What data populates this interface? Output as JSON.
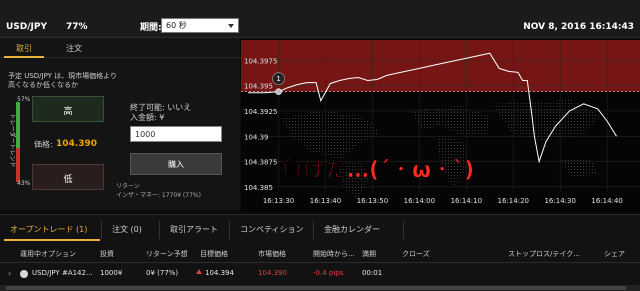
{
  "header": {
    "pair": "USD/JPY",
    "payout": "77%",
    "period_label": "期間:",
    "period_value": "60 秒",
    "datetime": "NOV 8, 2016 16:14:43"
  },
  "trade_panel": {
    "tabs": [
      {
        "label": "取引",
        "active": true
      },
      {
        "label": "注文",
        "active": false
      }
    ],
    "expectation_text": "予定 USD/JPY は、現市場価格より高くなるか低くなるか",
    "trader_trend_label": "トレーダートレンド",
    "high_pct": "57%",
    "low_pct": "43%",
    "high_pct_value": 57,
    "high_button": "高",
    "low_button": "低",
    "price_label": "価格:",
    "price_value": "104.390",
    "end_possible": "終了可能: いいえ",
    "deposit_label": "入金額: ¥",
    "amount_value": "1000",
    "purchase_button": "購入",
    "return_label": "リターン",
    "insider_money": "インザ・マネー: 1770¥ (77%)"
  },
  "chart_data": {
    "type": "line",
    "y_ticks": [
      "104.3975",
      "104.395",
      "104.3925",
      "104.39",
      "104.3875",
      "104.385"
    ],
    "y_tick_values": [
      104.3975,
      104.395,
      104.3925,
      104.39,
      104.3875,
      104.385
    ],
    "ylim": [
      104.3845,
      104.3995
    ],
    "x_ticks": [
      "16:13:30",
      "16:13:40",
      "16:13:50",
      "16:14:00",
      "16:14:10",
      "16:14:20",
      "16:14:30",
      "16:14:40"
    ],
    "x_tick_seconds": [
      0,
      10,
      20,
      30,
      40,
      50,
      60,
      70
    ],
    "xlim": [
      -8,
      77
    ],
    "series": [
      {
        "x": [
          -6.5,
          -3,
          0,
          2,
          4,
          6,
          8,
          9,
          11,
          13,
          15,
          17,
          19,
          21,
          23,
          25,
          27,
          29,
          31,
          33,
          35,
          37,
          39,
          41,
          43,
          45,
          47,
          49,
          51,
          52,
          53,
          54,
          54.5,
          55.5,
          57,
          59,
          62,
          65,
          68,
          70,
          72
        ],
        "y": [
          104.3943,
          104.3943,
          104.3944,
          104.3948,
          104.3951,
          104.3953,
          104.3953,
          104.3935,
          104.3952,
          104.3955,
          104.3957,
          104.3958,
          104.3955,
          104.3956,
          104.396,
          104.3962,
          104.3964,
          104.3966,
          104.3968,
          104.397,
          104.3972,
          104.3974,
          104.3976,
          104.3978,
          104.398,
          104.3982,
          104.3967,
          104.3964,
          104.3963,
          104.3955,
          104.3955,
          104.392,
          104.39,
          104.3875,
          104.3895,
          104.391,
          104.3925,
          104.3932,
          104.3927,
          104.3915,
          104.39
        ]
      }
    ],
    "entry_marker": {
      "label": "1",
      "x": 0,
      "y": 104.3944,
      "price_line": 104.3944
    },
    "annotation": "負けた…(´・ω・`)"
  },
  "colors": {
    "accent": "#e9b43a",
    "high_zone": "#8a1a17",
    "price": "#f0a500",
    "down": "#e04040"
  },
  "bottom": {
    "tabs": [
      {
        "label": "オープントレード (1)",
        "active": true
      },
      {
        "label": "注文 (0)",
        "active": false
      },
      {
        "label": "取引アラート",
        "active": false
      },
      {
        "label": "コンペティション",
        "active": false
      },
      {
        "label": "金融カレンダー",
        "active": false
      }
    ],
    "columns": [
      "運用中オプション",
      "投資",
      "リターン予想",
      "目標価格",
      "市場価格",
      "開始時から...",
      "満期",
      "クローズ",
      "ストップロス/テイク...",
      "シェア"
    ],
    "rows": [
      {
        "option": "USD/JPY #A142...",
        "investment": "1000¥",
        "expected_return": "0¥ (77%)",
        "target_price": "104.394",
        "market_price": "104.390",
        "since_start": "-0.4 pips",
        "expiry": "00:01",
        "close": "",
        "stoploss": "",
        "share": ""
      }
    ]
  }
}
